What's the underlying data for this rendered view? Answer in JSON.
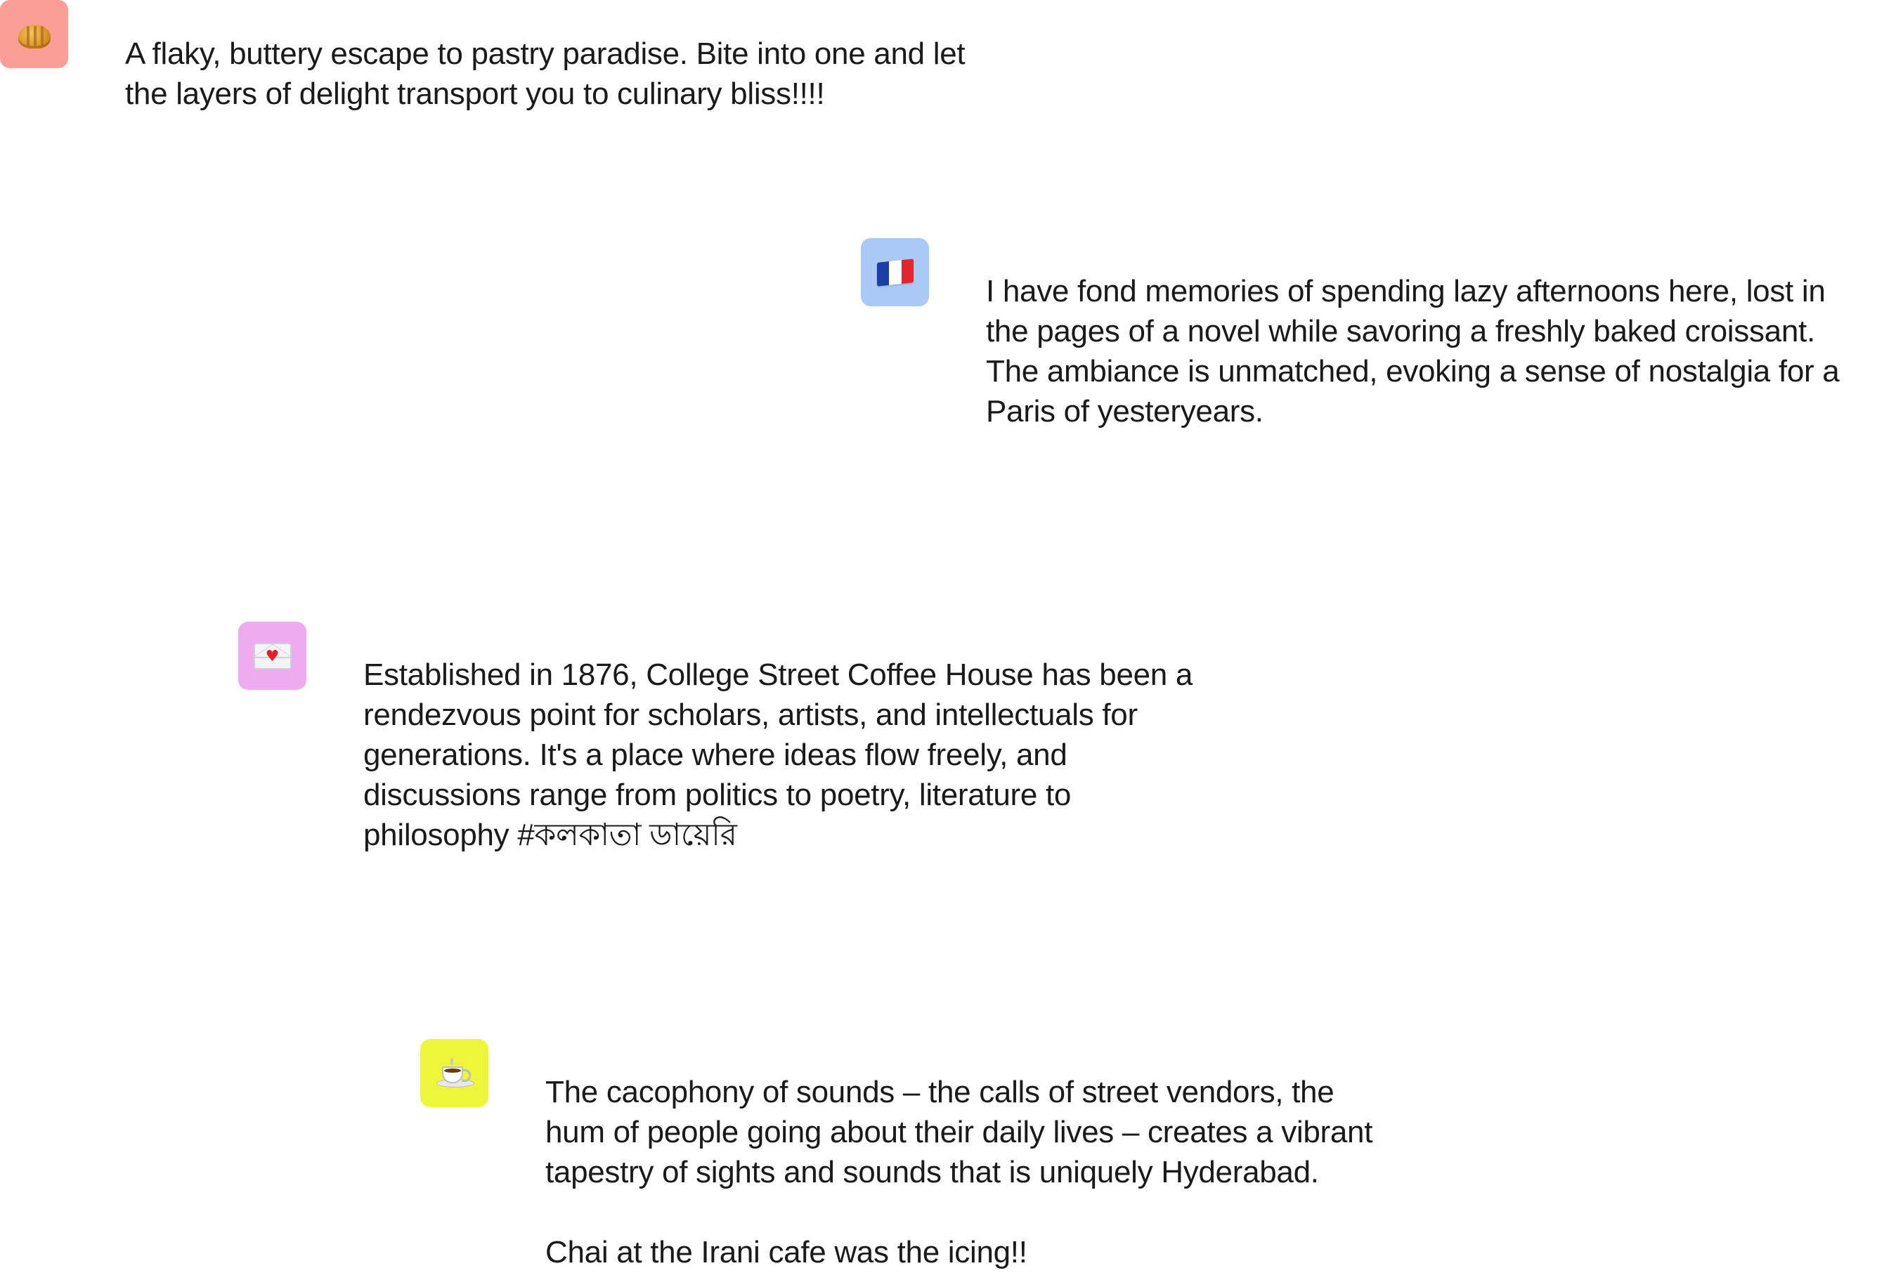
{
  "posts": [
    {
      "icon": "croissant-icon",
      "avatar_color": "#fb9e96",
      "text": "A flaky, buttery escape to pastry paradise. Bite into one and let\nthe layers of delight transport you to culinary bliss!!!!"
    },
    {
      "icon": "france-flag-icon",
      "avatar_color": "#a9c9f7",
      "text": "I have fond memories of spending lazy afternoons here, lost in\nthe pages of a novel while savoring a freshly baked croissant.\nThe ambiance is unmatched, evoking a sense of nostalgia for a\nParis of yesteryears."
    },
    {
      "icon": "love-letter-icon",
      "avatar_color": "#eeabef",
      "text": "Established in 1876, College Street Coffee House has been a\nrendezvous point for scholars, artists, and intellectuals for\ngenerations. It's a place where ideas flow freely, and\ndiscussions range from politics to poetry, literature to\nphilosophy #কলকাতা ডায়েরি"
    },
    {
      "icon": "hot-beverage-icon",
      "avatar_color": "#eef53a",
      "text": "The cacophony of sounds – the calls of street vendors, the\nhum of people going about their daily lives – creates a vibrant\ntapestry of sights and sounds that is uniquely Hyderabad.\n\nChai at the Irani cafe was the icing!!"
    }
  ]
}
